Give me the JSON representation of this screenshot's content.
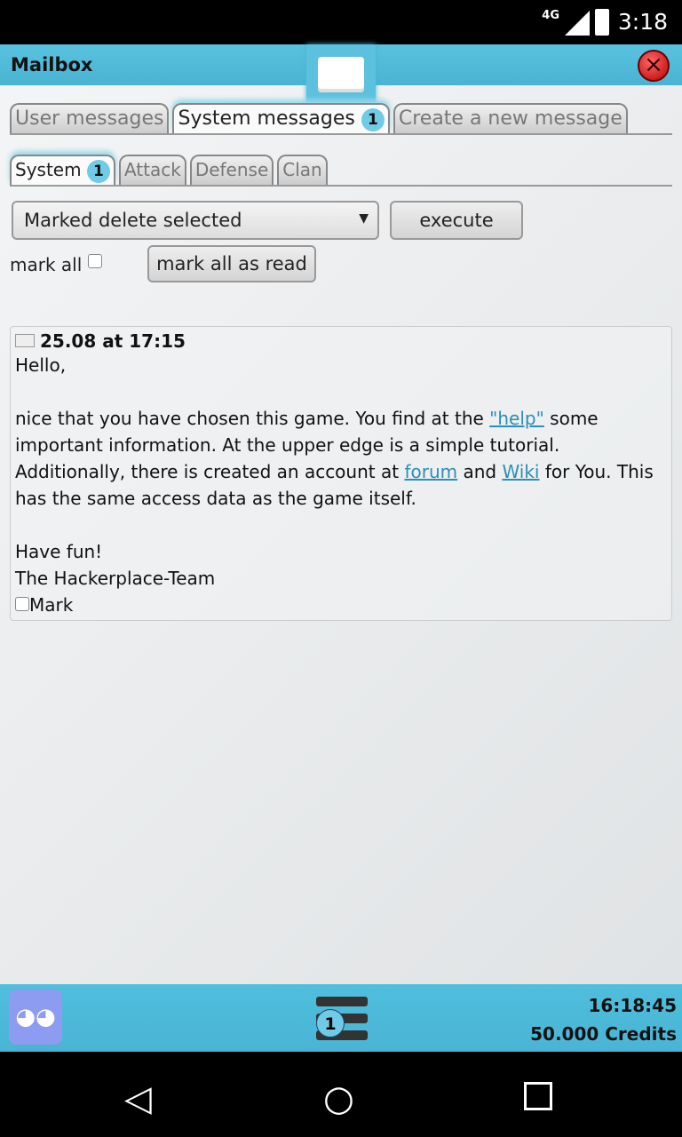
{
  "status_bar": {
    "network": "4G",
    "time": "3:18"
  },
  "header": {
    "title": "Mailbox"
  },
  "main_tabs": [
    {
      "label": "User messages"
    },
    {
      "label": "System messages",
      "badge": "1"
    },
    {
      "label": "Create a new message"
    }
  ],
  "sub_tabs": [
    {
      "label": "System",
      "badge": "1"
    },
    {
      "label": "Attack"
    },
    {
      "label": "Defense"
    },
    {
      "label": "Clan"
    }
  ],
  "actions": {
    "select_value": "Marked delete selected",
    "execute": "execute",
    "mark_all": "mark all",
    "mark_all_read": "mark all as read"
  },
  "message": {
    "date": "25.08 at 17:15",
    "greeting": "Hello,",
    "p1a": "nice that you have chosen this game. You find at the ",
    "help": "\"help\"",
    "p1b": " some important information. At the upper edge is a simple tutorial. Additionally, there is created an account at ",
    "forum": "forum",
    "and": " and ",
    "wiki": "Wiki",
    "p1c": " for You. This has the same access data as the game itself.",
    "fun": "Have fun!",
    "team": "The Hackerplace-Team",
    "mark": "Mark"
  },
  "footer": {
    "menu_badge": "1",
    "clock": "16:18:45",
    "credits": "50.000 Credits"
  },
  "colors": {
    "accent": "#4ab3d2",
    "link": "#2a8fb5",
    "badge": "#6fcbe6"
  }
}
